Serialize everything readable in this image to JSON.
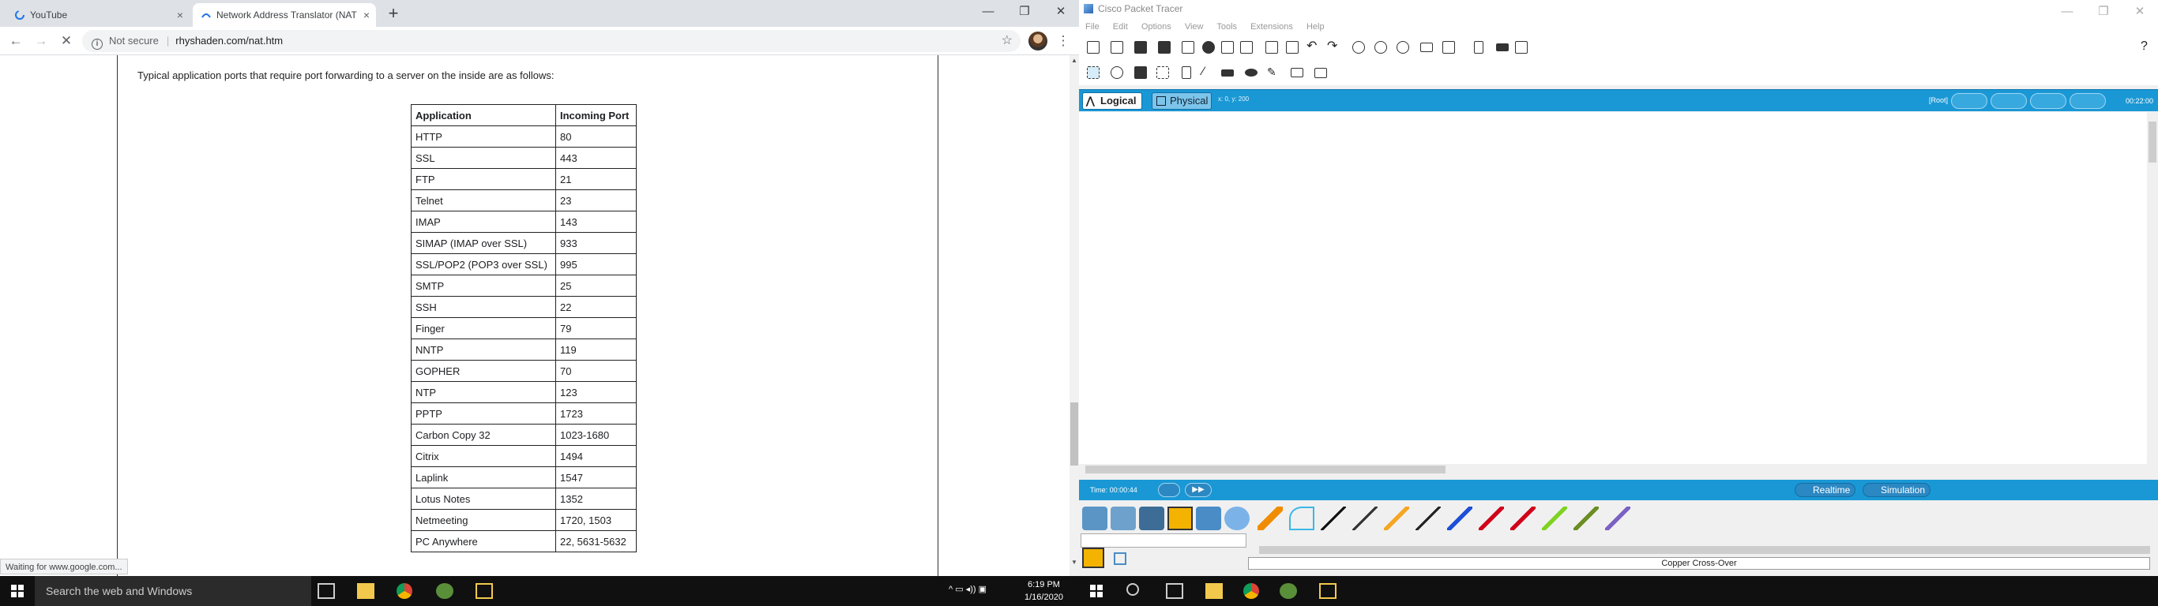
{
  "chrome": {
    "tabs": [
      {
        "title": "YouTube",
        "close": "×"
      },
      {
        "title": "Network Address Translator (NAT",
        "close": "×"
      }
    ],
    "new_tab": "+",
    "window_controls": {
      "minimize": "—",
      "maximize": "❐",
      "close": "✕"
    },
    "nav": {
      "back": "←",
      "forward": "→",
      "reload": "✕"
    },
    "address": {
      "security": "Not secure",
      "url": "rhyshaden.com/nat.htm",
      "star": "☆"
    },
    "menu": "⋮",
    "status": "Waiting for www.google.com..."
  },
  "page": {
    "intro": "Typical application ports that require port forwarding to a server on the inside are as follows:",
    "table": {
      "headers": [
        "Application",
        "Incoming Port"
      ],
      "rows": [
        [
          "HTTP",
          "80"
        ],
        [
          "SSL",
          "443"
        ],
        [
          "FTP",
          "21"
        ],
        [
          "Telnet",
          "23"
        ],
        [
          "IMAP",
          "143"
        ],
        [
          "SIMAP (IMAP over SSL)",
          "933"
        ],
        [
          "SSL/POP2 (POP3 over SSL)",
          "995"
        ],
        [
          "SMTP",
          "25"
        ],
        [
          "SSH",
          "22"
        ],
        [
          "Finger",
          "79"
        ],
        [
          "NNTP",
          "119"
        ],
        [
          "GOPHER",
          "70"
        ],
        [
          "NTP",
          "123"
        ],
        [
          "PPTP",
          "1723"
        ],
        [
          "Carbon Copy 32",
          "1023-1680"
        ],
        [
          "Citrix",
          "1494"
        ],
        [
          "Laplink",
          "1547"
        ],
        [
          "Lotus Notes",
          "1352"
        ],
        [
          "Netmeeting",
          "1720, 1503"
        ],
        [
          "PC Anywhere",
          "22, 5631-5632"
        ]
      ]
    }
  },
  "packet_tracer": {
    "title": "Cisco Packet Tracer",
    "window_controls": {
      "minimize": "—",
      "maximize": "❐",
      "close": "✕"
    },
    "menu": [
      "File",
      "Edit",
      "Options",
      "View",
      "Tools",
      "Extensions",
      "Help"
    ],
    "help": "?",
    "logical": "Logical",
    "physical": "Physical",
    "coords": "x: 0, y: 200",
    "root": "[Root]",
    "clock": "00:22:00",
    "time": "Time: 00:00:44",
    "realtime": "Realtime",
    "simulation": "Simulation",
    "cable_label": "Copper Cross-Over",
    "colors": {
      "bar": "#1a98d5"
    }
  },
  "taskbar": {
    "search_placeholder": "Search the web and Windows",
    "time": "6:19 PM",
    "date": "1/16/2020",
    "tray": "^ ▭ ◂)) ▣"
  }
}
